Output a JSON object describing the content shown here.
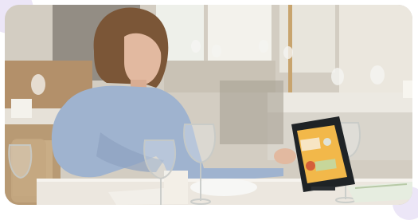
{
  "scene": {
    "description_tags": [
      "restaurant",
      "woman",
      "tablet-kiosk",
      "wine-glasses",
      "dining-table"
    ],
    "colors": {
      "wall": "#d6d1c7",
      "window": "#f1efe8",
      "table_cloth": "#e9e4dc",
      "shirt": "#9fb3cf",
      "hair": "#7b5637",
      "skin": "#e2b9a0",
      "chair": "#b89a74",
      "tablet": "#1f2326",
      "screen": "#f2b84a",
      "accent_lilac": "#ece6f7"
    }
  }
}
